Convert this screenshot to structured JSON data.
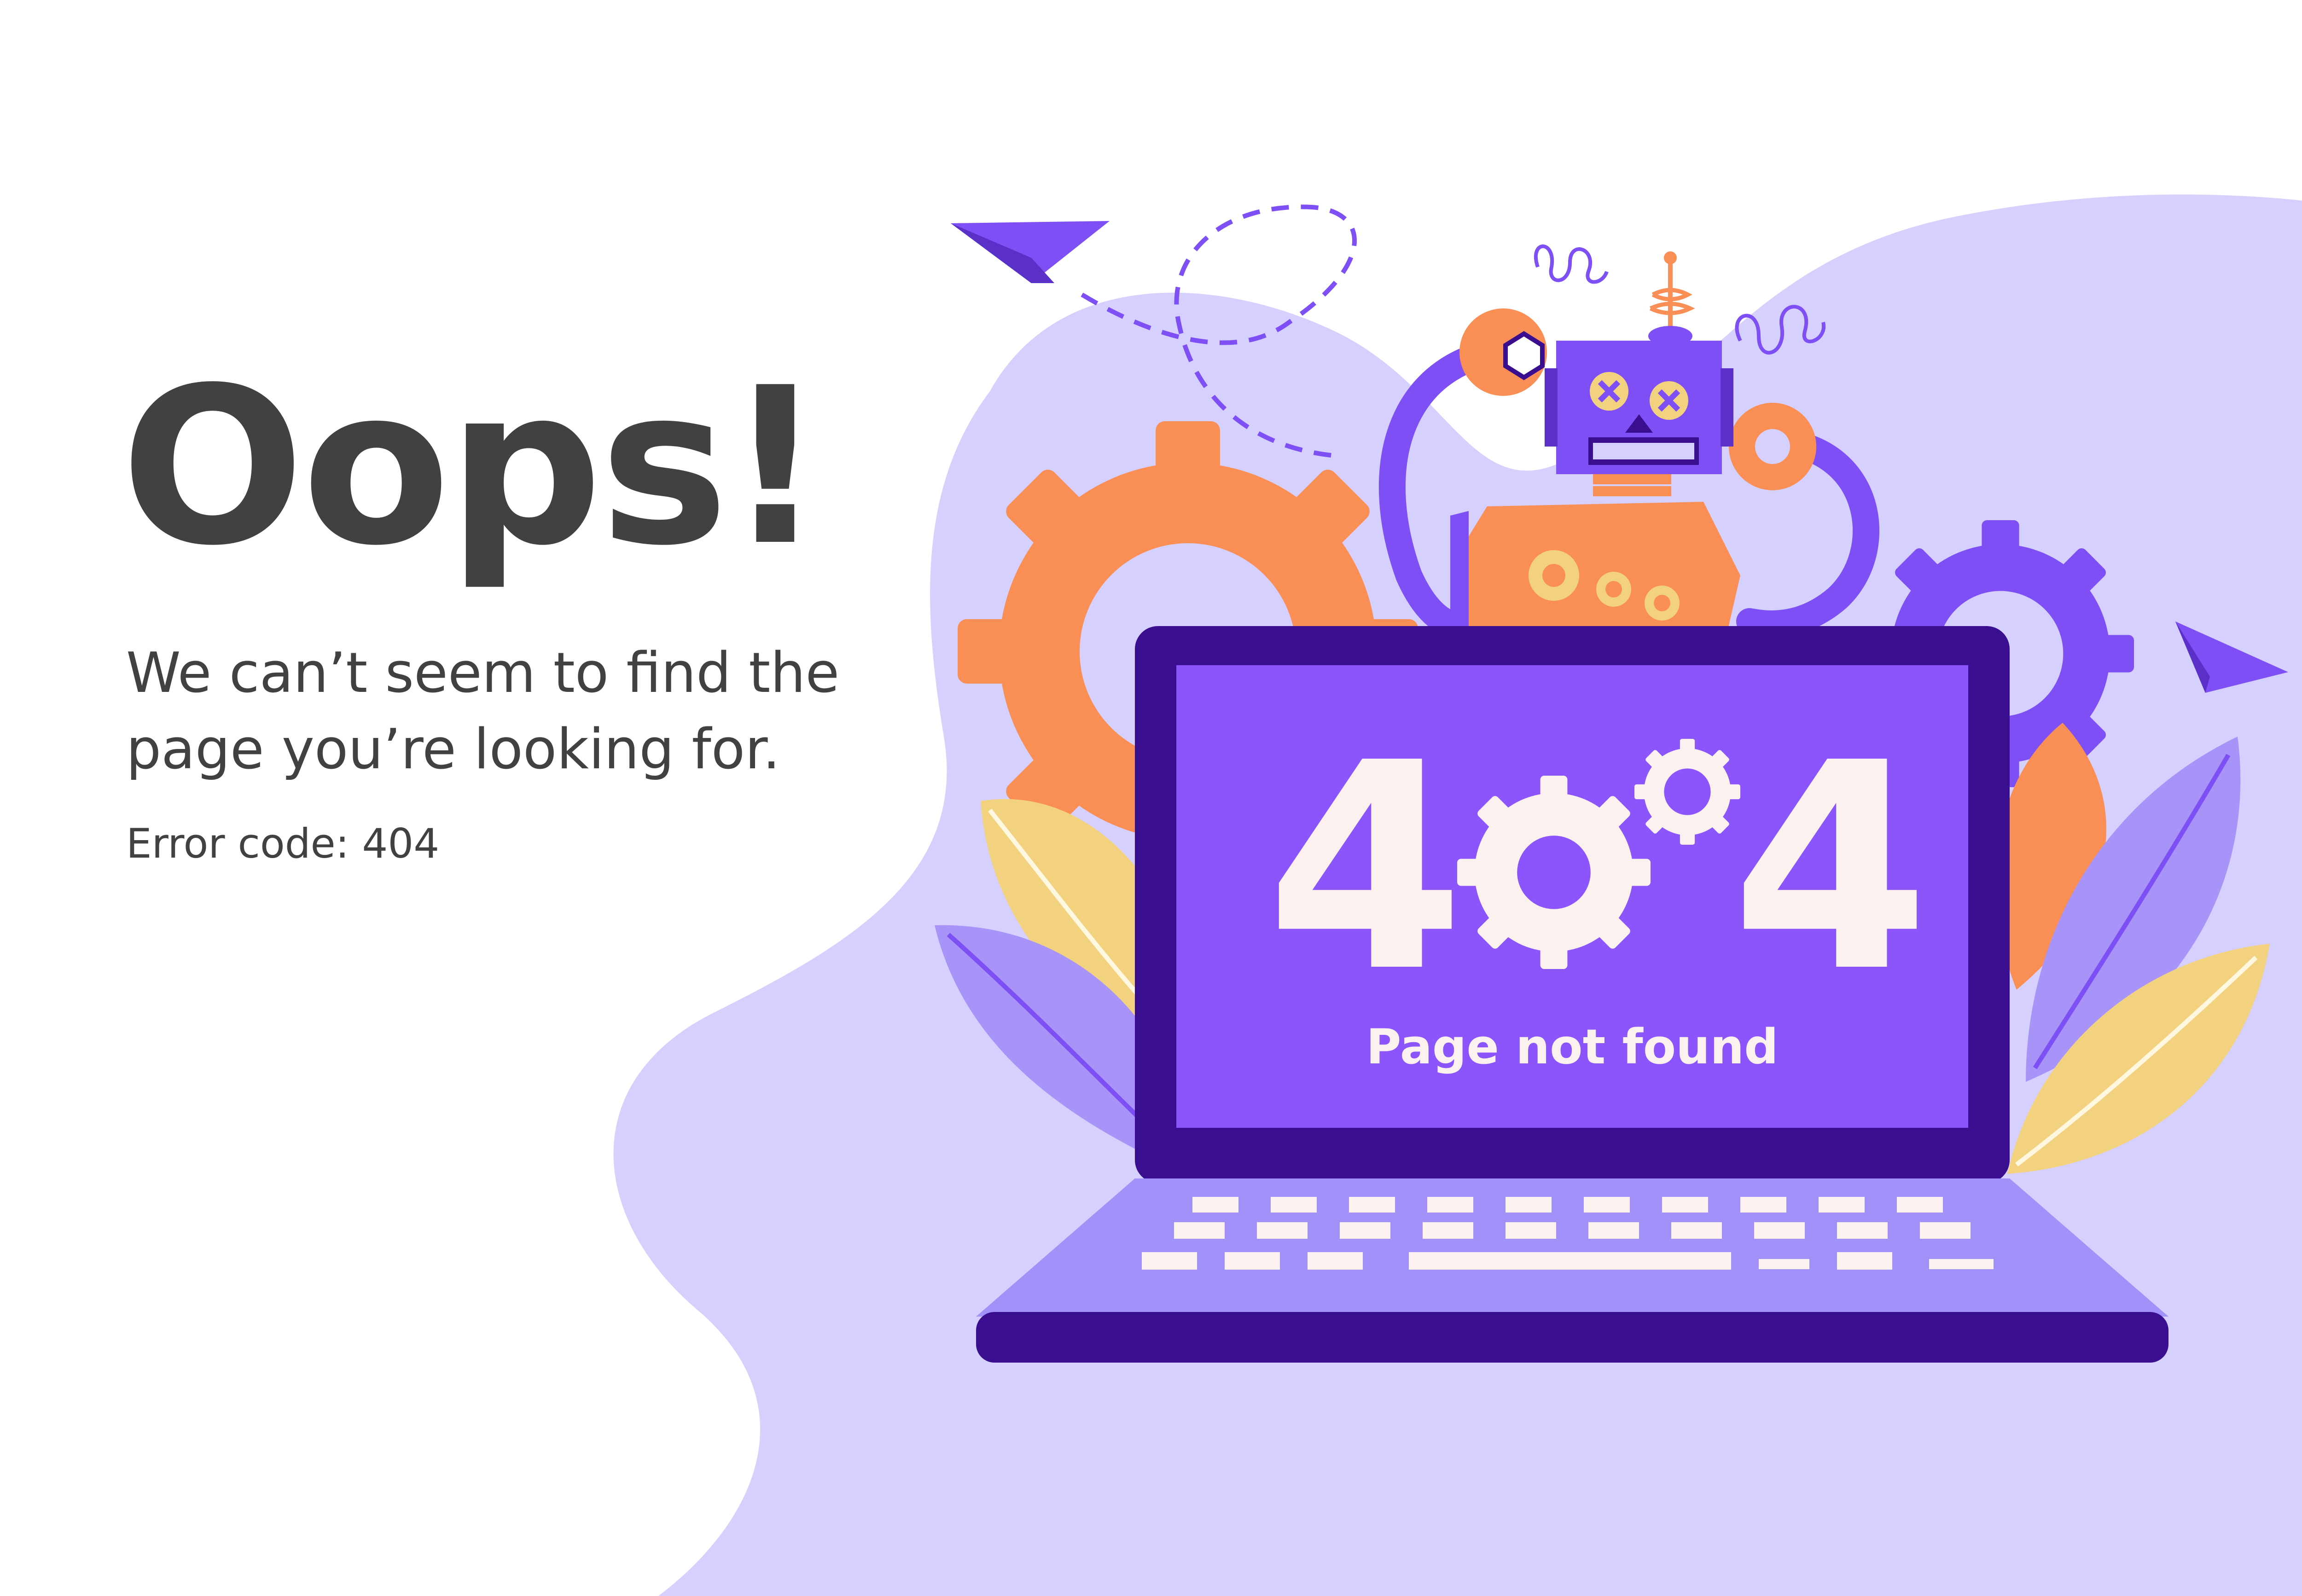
{
  "error": {
    "headline": "Oops!",
    "message": "We can’t seem to find the page you’re looking for.",
    "error_code_label": "Error code: 404"
  },
  "illustration": {
    "screen_digit_left": "4",
    "screen_digit_right": "4",
    "screen_caption": "Page not found",
    "icons": [
      "paper-plane-icon",
      "gear-icon",
      "robot-icon",
      "laptop-icon",
      "leaf-icon",
      "spring-icon"
    ]
  },
  "colors": {
    "background": "#ffffff",
    "blob": "#d5d0fd",
    "text": "#414141",
    "laptop_frame": "#3a0f8f",
    "screen": "#8c55fb",
    "keyboard_deck": "#a291f8",
    "orange": "#f98f55",
    "purple": "#7d4ff5",
    "yellow": "#f2d27f",
    "lavender_leaf": "#a894f8"
  }
}
